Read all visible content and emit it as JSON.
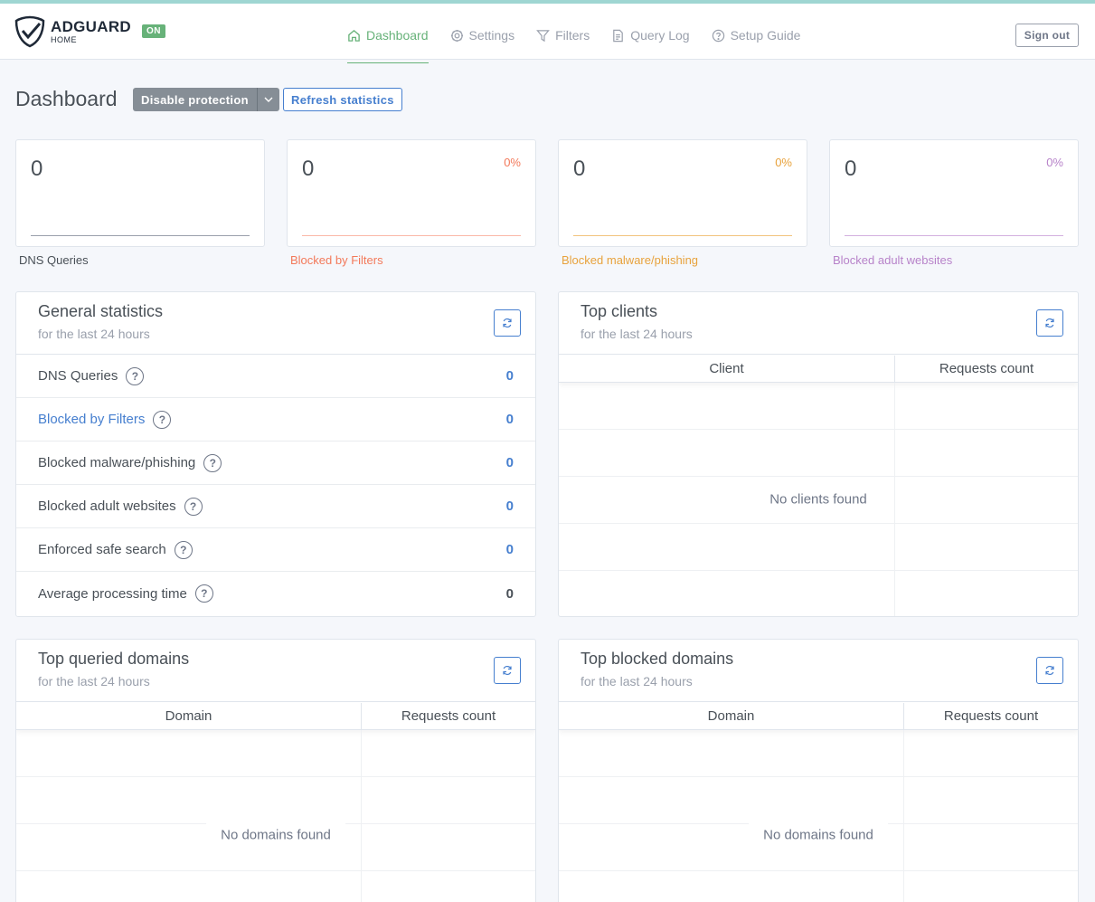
{
  "brand": {
    "name": "ADGUARD",
    "sub": "HOME",
    "status": "ON"
  },
  "nav": [
    {
      "label": "Dashboard",
      "icon": "home-icon",
      "active": true
    },
    {
      "label": "Settings",
      "icon": "gear-icon"
    },
    {
      "label": "Filters",
      "icon": "filter-icon"
    },
    {
      "label": "Query Log",
      "icon": "document-icon"
    },
    {
      "label": "Setup Guide",
      "icon": "help-circle-icon"
    }
  ],
  "signout": "Sign out",
  "page": {
    "title": "Dashboard",
    "disable_protection": "Disable protection",
    "refresh_statistics": "Refresh statistics"
  },
  "stat_cards": [
    {
      "value": "0",
      "percent": "",
      "label": "DNS Queries",
      "color": "#6e7687",
      "line_color": "#9aa0ac"
    },
    {
      "value": "0",
      "percent": "0%",
      "label": "Blocked by Filters",
      "color": "#f3795a",
      "line_color": "#fbb8a8"
    },
    {
      "value": "0",
      "percent": "0%",
      "label": "Blocked malware/phishing",
      "color": "#e8a23c",
      "line_color": "#f2c47e"
    },
    {
      "value": "0",
      "percent": "0%",
      "label": "Blocked adult websites",
      "color": "#b782c9",
      "line_color": "#d3b0df"
    }
  ],
  "general_stats": {
    "title": "General statistics",
    "subtitle": "for the last 24 hours",
    "rows": [
      {
        "label": "DNS Queries",
        "value": "0",
        "label_color": "#495057",
        "value_color": "#467fcf"
      },
      {
        "label": "Blocked by Filters",
        "value": "0",
        "label_color": "#467fcf",
        "value_color": "#467fcf"
      },
      {
        "label": "Blocked malware/phishing",
        "value": "0",
        "label_color": "#495057",
        "value_color": "#467fcf"
      },
      {
        "label": "Blocked adult websites",
        "value": "0",
        "label_color": "#495057",
        "value_color": "#467fcf"
      },
      {
        "label": "Enforced safe search",
        "value": "0",
        "label_color": "#495057",
        "value_color": "#467fcf"
      },
      {
        "label": "Average processing time",
        "value": "0",
        "label_color": "#495057",
        "value_color": "#495057"
      }
    ]
  },
  "top_clients": {
    "title": "Top clients",
    "subtitle": "for the last 24 hours",
    "col1": "Client",
    "col2": "Requests count",
    "empty": "No clients found"
  },
  "top_queried": {
    "title": "Top queried domains",
    "subtitle": "for the last 24 hours",
    "col1": "Domain",
    "col2": "Requests count",
    "empty": "No domains found"
  },
  "top_blocked": {
    "title": "Top blocked domains",
    "subtitle": "for the last 24 hours",
    "col1": "Domain",
    "col2": "Requests count",
    "empty": "No domains found"
  }
}
